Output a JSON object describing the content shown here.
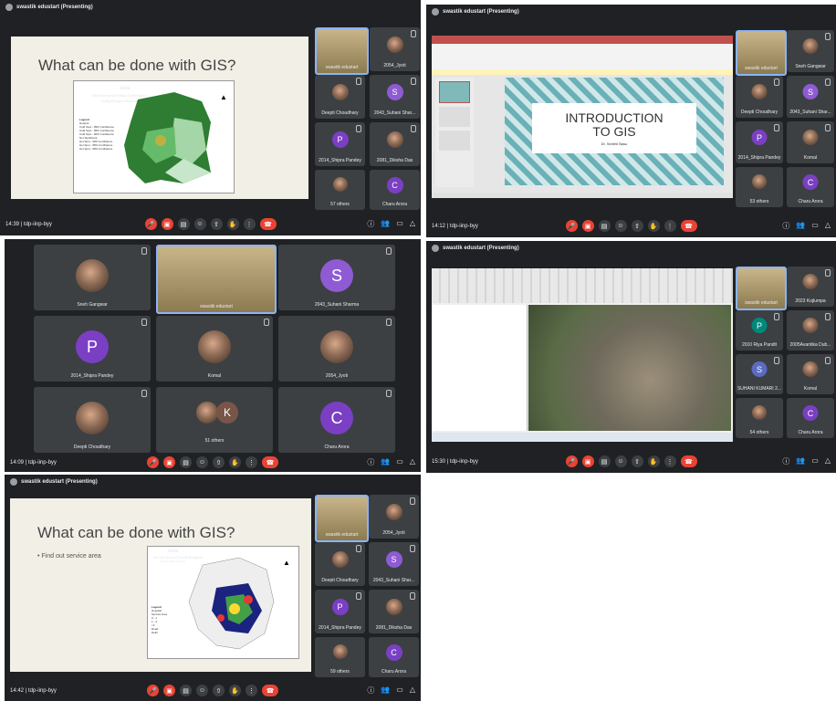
{
  "meeting_code": "tdp-iinp-byy",
  "presenter_label": "swastik edustart (Presenting)",
  "speaker_tile_name": "swastik edustart",
  "screens": [
    {
      "time": "14:39",
      "slide": {
        "title": "What can be done with GIS?",
        "map_title": "Delhi",
        "map_subtitle": "Distribution of Urban Green Space",
        "map_subtitle2": "Using Hotspot Analysis",
        "legend_title": "Legend",
        "legend_items": [
          "Hotspot",
          "Cold Spot - 99% Confidence",
          "Cold Spot - 95% Confidence",
          "Cold Spot - 90% Confidence",
          "Not Significant",
          "Hot Spot - 90% Confidence",
          "Hot Spot - 95% Confidence",
          "Hot Spot - 99% Confidence"
        ]
      },
      "participants": [
        "2054_Jyoti",
        "Deepti Choudhary",
        "2043_Suhani Shar...",
        "2014_Shipra Pandey",
        "2081_Diksha Das",
        "57 others",
        "Charu Arora"
      ]
    },
    {
      "time": "14:12",
      "slide": {
        "title": "INTRODUCTION TO GIS",
        "subtitle": "Dr. Senthil Basu"
      },
      "participants": [
        "Sneh Gangwar",
        "Deepti Choudhary",
        "2043_Suhani Shar...",
        "2014_Shipra Pandey",
        "Komal",
        "53 others",
        "Charu Arora"
      ]
    },
    {
      "time": "14:09",
      "grid": [
        "Sneh Gangwar",
        "swastik edustart",
        "2043_Suhani Sharma",
        "2014_Shipra Pandey",
        "Komal",
        "2054_Jyoti",
        "Deepti Choudhary",
        "51 others",
        "Charu Arora"
      ]
    },
    {
      "time": "15:30",
      "participants": [
        "2023 Kojlumpa",
        "2010 Riya Pandit",
        "2005Avantika Dub...",
        "SUHANI KUMARI 2...",
        "Komal",
        "54 others",
        "Charu Arora"
      ]
    },
    {
      "time": "14:42",
      "slide": {
        "title": "What can be done with GIS?",
        "bullet": "Find out service area",
        "map_title": "Delhi",
        "map_subtitle": "Service Area of Covid Hospitals",
        "map_subtitle2": "(within 2km Distance)",
        "legend_title": "Legend",
        "legend_items": [
          "Hospital",
          "Service Area",
          "0 - 1",
          "1 - 2",
          ">2",
          "Road",
          "Delhi"
        ]
      },
      "participants": [
        "2054_Jyoti",
        "Deepti Choudhary",
        "2043_Suhani Shar...",
        "2014_Shipra Pandey",
        "2081_Diksha Das",
        "59 others",
        "Charu Arora"
      ]
    }
  ],
  "colors": {
    "bg": "#202124",
    "tile": "#3c4043",
    "red": "#ea4335",
    "purple": "#7b3fc4",
    "blue_ring": "#8ab4f8"
  }
}
